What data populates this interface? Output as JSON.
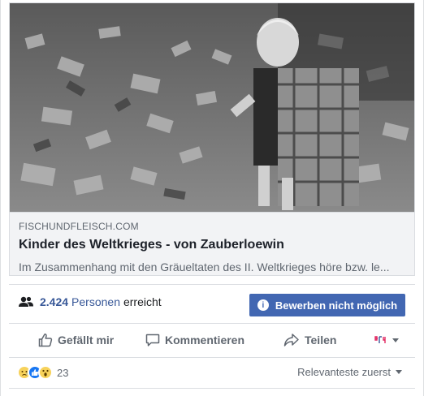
{
  "preview": {
    "domain": "FISCHUNDFLEISCH.COM",
    "title": "Kinder des Weltkrieges - von Zauberloewin",
    "excerpt": "Im Zusammenhang mit den Gräueltaten des II. Weltkrieges höre bzw. le..."
  },
  "reach": {
    "count": "2.424",
    "people": "Personen",
    "reached": "erreicht"
  },
  "boost": {
    "label": "Bewerben nicht möglich"
  },
  "actions": {
    "like": "Gefällt mir",
    "comment": "Kommentieren",
    "share": "Teilen"
  },
  "reactions": {
    "count": "23",
    "sort_label": "Relevanteste zuerst"
  },
  "colors": {
    "link": "#385898",
    "button": "#4267b2",
    "muted": "#606770"
  }
}
